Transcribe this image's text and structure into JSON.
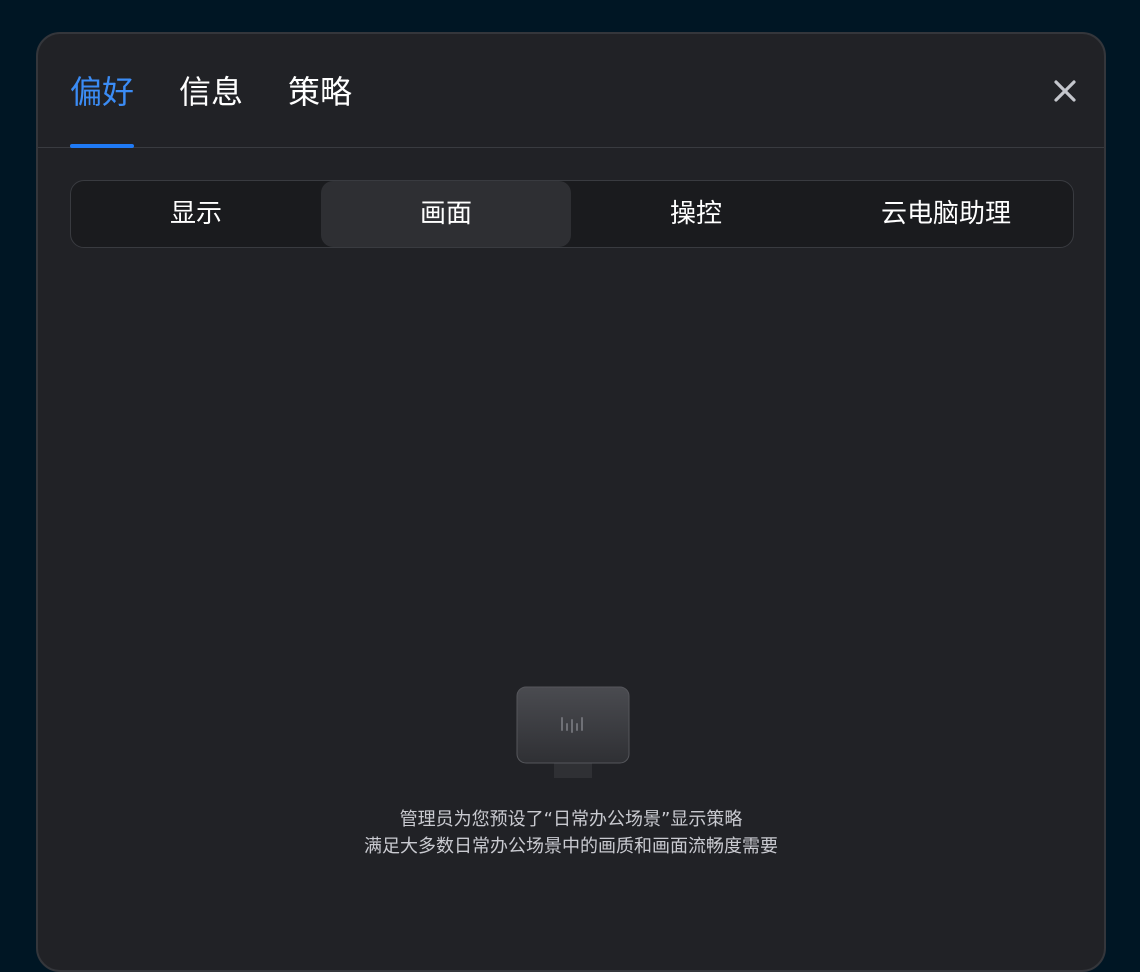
{
  "tabs": [
    {
      "label": "偏好",
      "active": true
    },
    {
      "label": "信息",
      "active": false
    },
    {
      "label": "策略",
      "active": false
    }
  ],
  "close_icon": "close-icon",
  "segments": [
    {
      "label": "显示",
      "active": false
    },
    {
      "label": "画面",
      "active": true
    },
    {
      "label": "操控",
      "active": false
    },
    {
      "label": "云电脑助理",
      "active": false
    }
  ],
  "empty_state": {
    "icon": "monitor-icon",
    "line1": "管理员为您预设了“日常办公场景”显示策略",
    "line2": "满足大多数日常办公场景中的画质和画面流畅度需要"
  },
  "colors": {
    "accent": "#1f7af5",
    "background": "#001624",
    "panel": "#212226"
  }
}
